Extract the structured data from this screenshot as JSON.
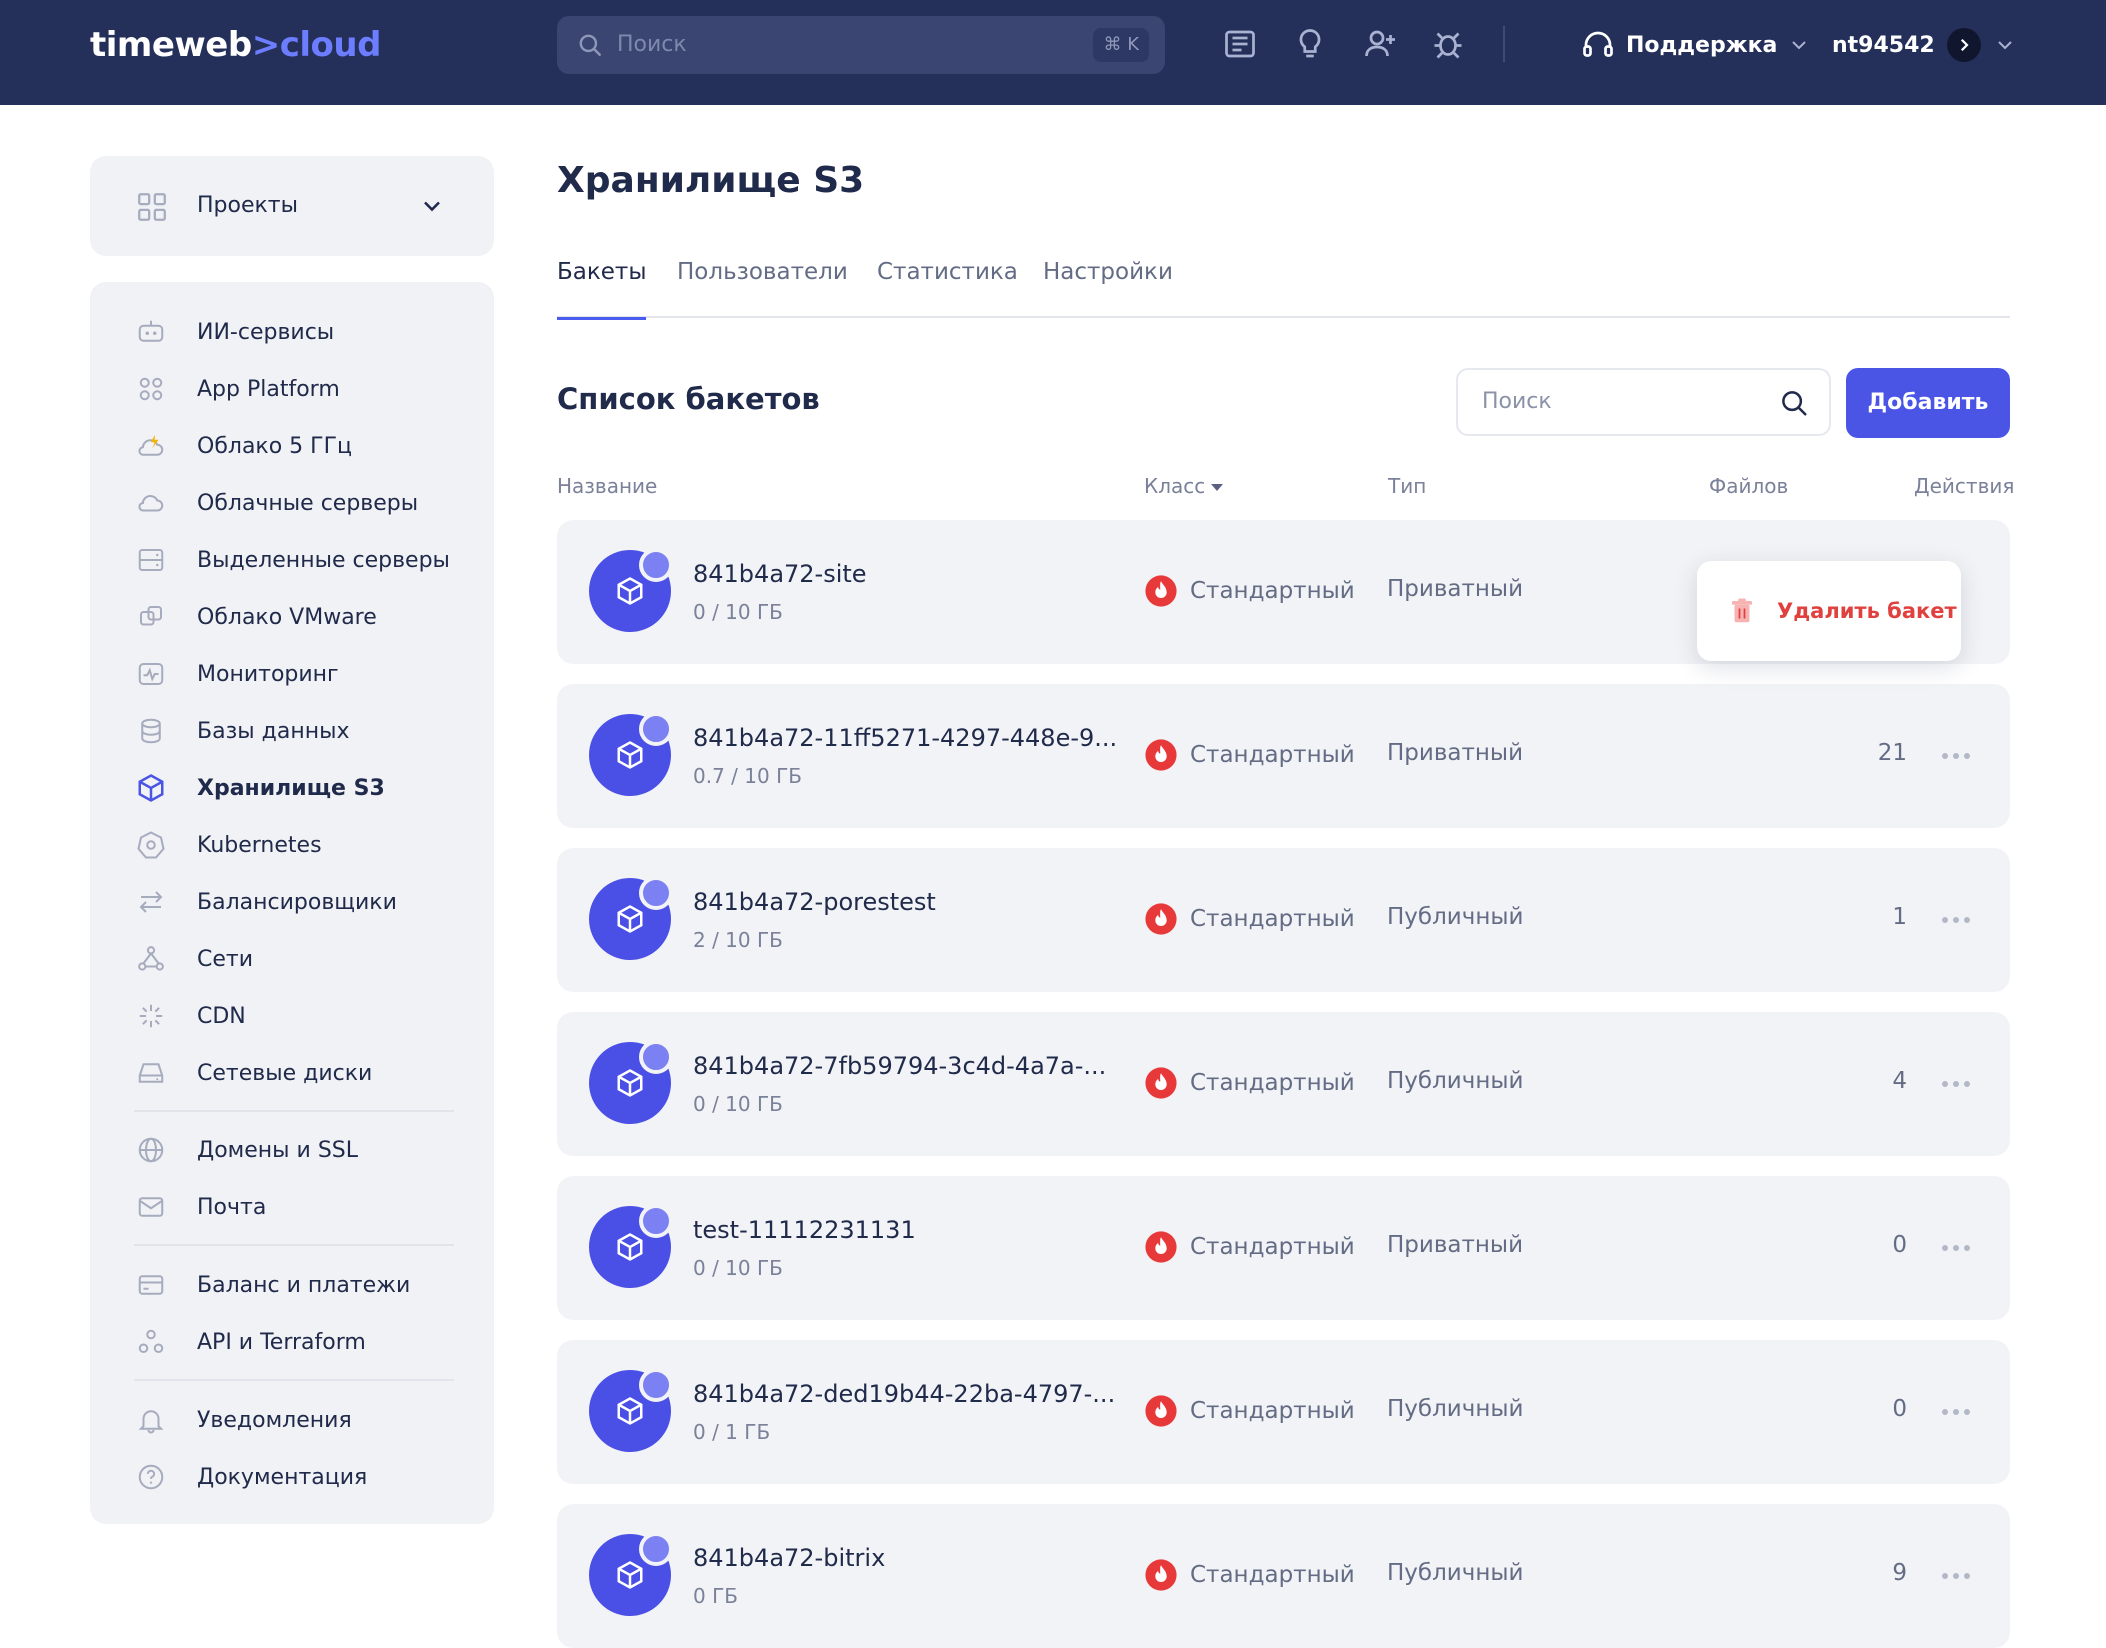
{
  "header": {
    "logo_main": "timeweb",
    "logo_sep": ">",
    "logo_accent": "cloud",
    "search_placeholder": "Поиск",
    "search_shortcut": "⌘ K",
    "support_label": "Поддержка",
    "username": "nt94542"
  },
  "sidebar": {
    "projects_label": "Проекты",
    "items": [
      {
        "label": "ИИ-сервисы",
        "icon": "robot-icon"
      },
      {
        "label": "App Platform",
        "icon": "app-grid-icon"
      },
      {
        "label": "Облако 5 ГГц",
        "icon": "cloud-bolt-icon"
      },
      {
        "label": "Облачные серверы",
        "icon": "cloud-icon"
      },
      {
        "label": "Выделенные серверы",
        "icon": "server-icon"
      },
      {
        "label": "Облако VMware",
        "icon": "vmware-icon"
      },
      {
        "label": "Мониторинг",
        "icon": "monitoring-icon"
      },
      {
        "label": "Базы данных",
        "icon": "database-icon"
      },
      {
        "label": "Хранилище S3",
        "icon": "cube-icon"
      },
      {
        "label": "Kubernetes",
        "icon": "kubernetes-icon"
      },
      {
        "label": "Балансировщики",
        "icon": "balancer-icon"
      },
      {
        "label": "Сети",
        "icon": "network-icon"
      },
      {
        "label": "CDN",
        "icon": "cdn-icon"
      },
      {
        "label": "Сетевые диски",
        "icon": "disk-icon"
      },
      {
        "label": "Домены и SSL",
        "icon": "globe-icon"
      },
      {
        "label": "Почта",
        "icon": "mail-icon"
      },
      {
        "label": "Баланс и платежи",
        "icon": "card-icon"
      },
      {
        "label": "API и Terraform",
        "icon": "api-icon"
      },
      {
        "label": "Уведомления",
        "icon": "bell-icon"
      },
      {
        "label": "Документация",
        "icon": "help-icon"
      }
    ],
    "active_index": 8
  },
  "main": {
    "title": "Хранилище S3",
    "tabs": [
      "Бакеты",
      "Пользователи",
      "Статистика",
      "Настройки"
    ],
    "active_tab": 0,
    "list_title": "Список бакетов",
    "search_placeholder": "Поиск",
    "add_button": "Добавить",
    "columns": {
      "name": "Название",
      "class": "Класс",
      "type": "Тип",
      "files": "Файлов",
      "actions": "Действия"
    },
    "buckets": [
      {
        "name": "841b4a72-site",
        "size": "0 / 10 ГБ",
        "class": "Стандартный",
        "type": "Приватный",
        "files": ""
      },
      {
        "name": "841b4a72-11ff5271-4297-448e-9...",
        "size": "0.7 / 10 ГБ",
        "class": "Стандартный",
        "type": "Приватный",
        "files": "21"
      },
      {
        "name": "841b4a72-porestest",
        "size": "2 / 10 ГБ",
        "class": "Стандартный",
        "type": "Публичный",
        "files": "1"
      },
      {
        "name": "841b4a72-7fb59794-3c4d-4a7a-...",
        "size": "0 / 10 ГБ",
        "class": "Стандартный",
        "type": "Публичный",
        "files": "4"
      },
      {
        "name": "test-11112231131",
        "size": "0 / 10 ГБ",
        "class": "Стандартный",
        "type": "Приватный",
        "files": "0"
      },
      {
        "name": "841b4a72-ded19b44-22ba-4797-...",
        "size": "0 / 1 ГБ",
        "class": "Стандартный",
        "type": "Публичный",
        "files": "0"
      },
      {
        "name": "841b4a72-bitrix",
        "size": "0 ГБ",
        "class": "Стандартный",
        "type": "Публичный",
        "files": "9"
      }
    ],
    "popup_delete": "Удалить бакет"
  },
  "colors": {
    "header_bg": "#25305a",
    "accent": "#4a55e6",
    "danger": "#e0413f"
  }
}
